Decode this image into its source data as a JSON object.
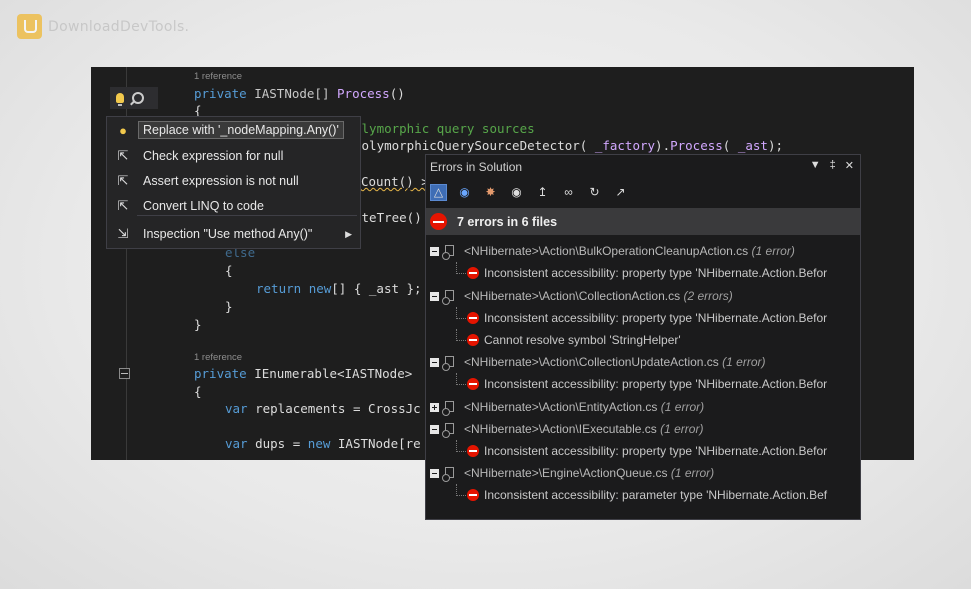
{
  "watermark": {
    "text": "DownloadDevTools."
  },
  "editor": {
    "ref1": "1 reference",
    "ref2": "1 reference",
    "lines": {
      "l1_kw": "private",
      "l1_type": "IASTNode[]",
      "l1_fn": "Process",
      "l1_tail": "()",
      "l2": "{",
      "l3_cm": "olymorphic query sources",
      "l4_pre": "PolymorphicQuerySourceDetector(",
      "l4_id1": "_factory",
      "l4_mid": ").",
      "l4_fn": "Process",
      "l4_p": "(",
      "l4_id2": "_ast",
      "l4_end": ");",
      "l5": "Count() >",
      "l6": "ateTree()",
      "l7": "else",
      "l8": "{",
      "l9_kw1": "return",
      "l9_kw2": "new",
      "l9_tail": "[] { _ast };",
      "l10": "}",
      "l11": "}",
      "l12_kw": "private",
      "l12_rest": "IEnumerable<IASTNode>",
      "l13": "{",
      "l14_kw": "var",
      "l14_rest": "replacements = CrossJc",
      "l15_kw": "var",
      "l15_mid": "dups =",
      "l15_kw2": "new",
      "l15_rest": "IASTNode[re"
    }
  },
  "quickfix": {
    "items": [
      {
        "label": "Replace with '_nodeMapping.Any()'",
        "icon": "lightbulb-icon"
      },
      {
        "label": "Check expression for null",
        "icon": "hammer-icon"
      },
      {
        "label": "Assert expression is not null",
        "icon": "hammer-icon"
      },
      {
        "label": "Convert LINQ to code",
        "icon": "hammer-icon"
      },
      {
        "label": "Inspection \"Use method Any()\"",
        "icon": "wrench-icon"
      }
    ]
  },
  "errors_panel": {
    "title": "Errors in Solution",
    "summary": "7 errors in 6 files",
    "rows": [
      {
        "type": "file",
        "path": "<NHibernate>\\Action\\BulkOperationCleanupAction.cs",
        "count": "(1 error)"
      },
      {
        "type": "error",
        "message": "Inconsistent accessibility: property type 'NHibernate.Action.Befor"
      },
      {
        "type": "file",
        "path": "<NHibernate>\\Action\\CollectionAction.cs",
        "count": "(2 errors)"
      },
      {
        "type": "error",
        "message": "Inconsistent accessibility: property type 'NHibernate.Action.Befor"
      },
      {
        "type": "error",
        "message": "Cannot resolve symbol 'StringHelper'"
      },
      {
        "type": "file",
        "path": "<NHibernate>\\Action\\CollectionUpdateAction.cs",
        "count": "(1 error)"
      },
      {
        "type": "error",
        "message": "Inconsistent accessibility: property type 'NHibernate.Action.Befor"
      },
      {
        "type": "file",
        "path": "<NHibernate>\\Action\\EntityAction.cs",
        "count": "(1 error)",
        "collapsed": true
      },
      {
        "type": "file",
        "path": "<NHibernate>\\Action\\IExecutable.cs",
        "count": "(1 error)"
      },
      {
        "type": "error",
        "message": "Inconsistent accessibility: property type 'NHibernate.Action.Befor"
      },
      {
        "type": "file",
        "path": "<NHibernate>\\Engine\\ActionQueue.cs",
        "count": "(1 error)"
      },
      {
        "type": "error",
        "message": "Inconsistent accessibility: parameter type 'NHibernate.Action.Bef"
      }
    ]
  }
}
